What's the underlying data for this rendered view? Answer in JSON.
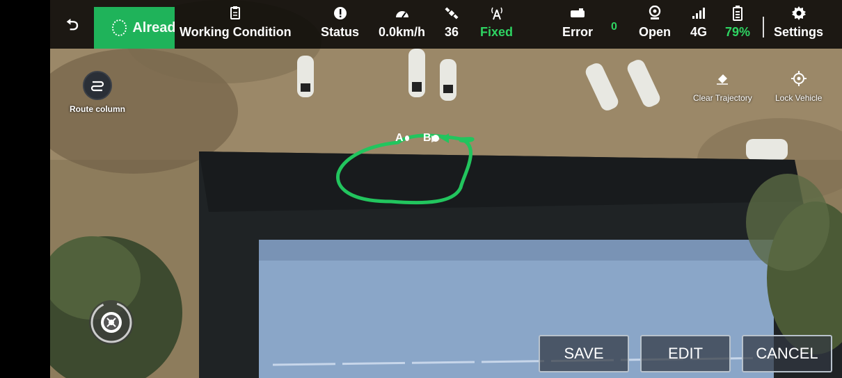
{
  "header": {
    "connection": "Already connected",
    "stats": [
      {
        "icon": "clipboard-icon",
        "label": "Working Condition"
      },
      {
        "icon": "alert-icon",
        "label": "Status"
      },
      {
        "icon": "speedometer-icon",
        "label": "0.0km/h"
      },
      {
        "icon": "satellite-icon",
        "label": "36"
      },
      {
        "icon": "signal-tower-icon",
        "label": "Fixed"
      },
      {
        "icon": "error-device-icon",
        "label": "Error",
        "count": "0"
      },
      {
        "icon": "camera-icon",
        "label": "Open"
      },
      {
        "icon": "cell-signal-icon",
        "label": "4G"
      },
      {
        "icon": "battery-icon",
        "label": "79%"
      },
      {
        "icon": "gear-icon",
        "label": "Settings"
      }
    ]
  },
  "left_panel": {
    "route_label": "Route column"
  },
  "right_panel": {
    "clear_label": "Clear Trajectory",
    "lock_label": "Lock Vehicle"
  },
  "map": {
    "marker_a": "A",
    "marker_b": "B",
    "route_color": "#22c55e"
  },
  "actions": {
    "save": "SAVE",
    "edit": "EDIT",
    "cancel": "CANCEL"
  }
}
